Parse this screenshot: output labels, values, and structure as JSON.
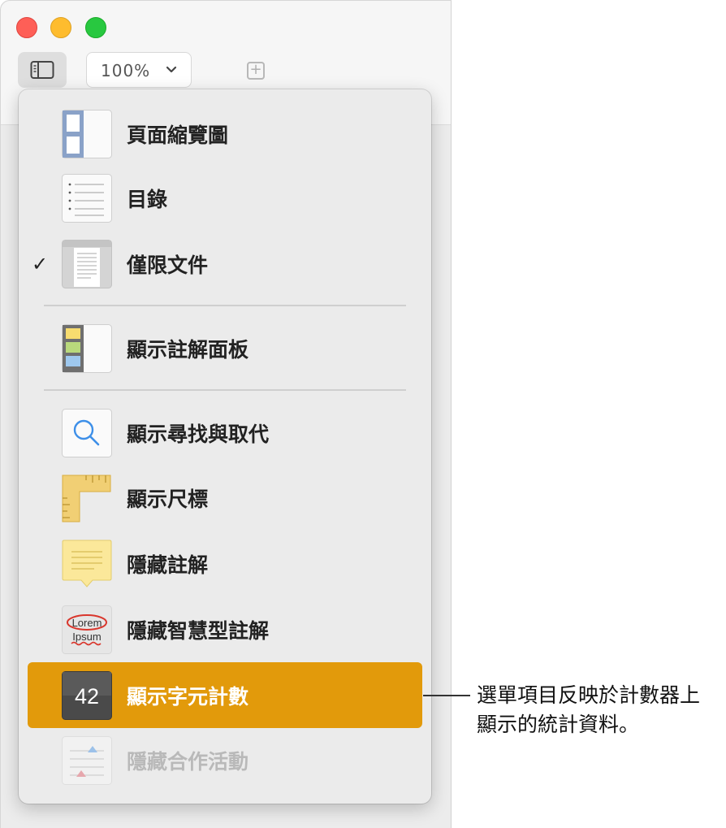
{
  "toolbar": {
    "zoom_value": "100%",
    "zoom_chevron": "⌄",
    "add_label": "+",
    "sidebar_icon": "sidebar-icon"
  },
  "menu": {
    "items": [
      {
        "label": "頁面縮覽圖",
        "icon": "page-thumbnails-icon",
        "checked": false,
        "disabled": false
      },
      {
        "label": "目錄",
        "icon": "table-of-contents-icon",
        "checked": false,
        "disabled": false
      },
      {
        "label": "僅限文件",
        "icon": "document-only-icon",
        "checked": true,
        "check_mark": "✓",
        "disabled": false
      },
      {
        "label": "顯示註解面板",
        "icon": "comments-pane-icon",
        "checked": false,
        "disabled": false
      },
      {
        "label": "顯示尋找與取代",
        "icon": "search-icon",
        "checked": false,
        "disabled": false
      },
      {
        "label": "顯示尺標",
        "icon": "ruler-icon",
        "checked": false,
        "disabled": false
      },
      {
        "label": "隱藏註解",
        "icon": "comment-note-icon",
        "checked": false,
        "disabled": false
      },
      {
        "label": "隱藏智慧型註解",
        "icon": "smart-annotation-icon",
        "icon_text_top": "Lorem",
        "icon_text_bottom": "Ipsum",
        "checked": false,
        "disabled": false
      },
      {
        "label": "顯示字元計數",
        "icon": "word-count-icon",
        "icon_text": "42",
        "checked": false,
        "disabled": false,
        "highlighted": true
      },
      {
        "label": "隱藏合作活動",
        "icon": "collaboration-activity-icon",
        "checked": false,
        "disabled": true
      }
    ]
  },
  "callout": {
    "line1": "選單項目反映於計數器上",
    "line2": "顯示的統計資料。"
  },
  "colors": {
    "highlight": "#e29a0b",
    "close": "#fe5f57",
    "minimize": "#febc2e",
    "maximize": "#28c840"
  }
}
